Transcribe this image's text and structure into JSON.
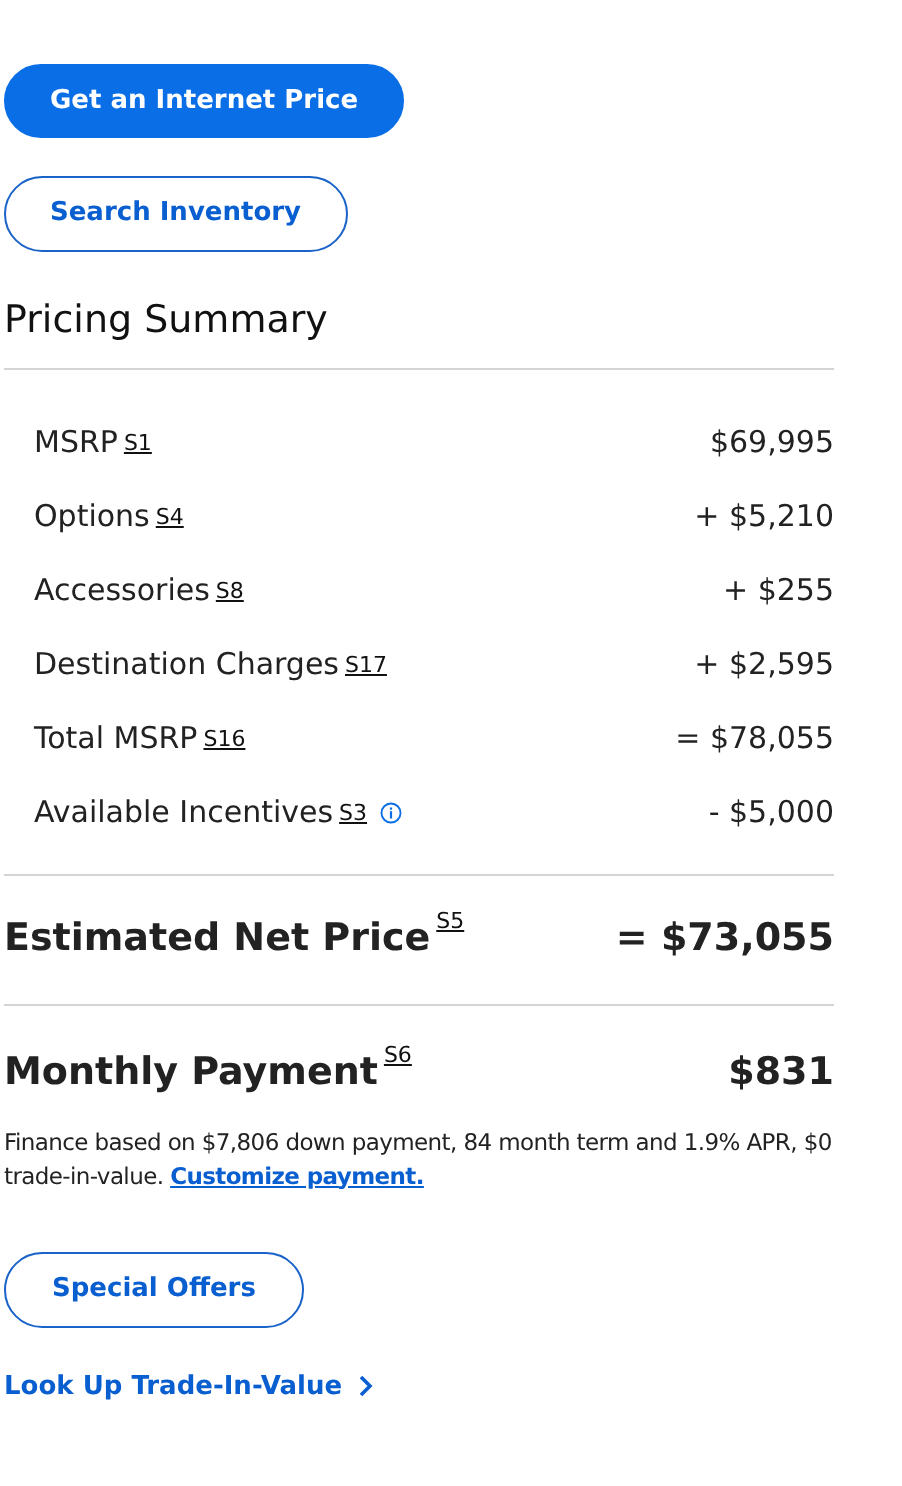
{
  "actions": [
    {
      "label": "Get an Internet Price",
      "kind": "primary"
    },
    {
      "label": "Search Inventory",
      "kind": "outline"
    }
  ],
  "pricing_summary": {
    "title": "Pricing Summary",
    "rows": [
      {
        "label": "MSRP",
        "note": "S1",
        "value": "$69,995",
        "info": false
      },
      {
        "label": "Options",
        "note": "S4",
        "value": "+ $5,210",
        "info": false
      },
      {
        "label": "Accessories",
        "note": "S8",
        "value": "+ $255",
        "info": false
      },
      {
        "label": "Destination Charges",
        "note": "S17",
        "value": "+ $2,595",
        "info": false
      },
      {
        "label": "Total MSRP",
        "note": "S16",
        "value": "= $78,055",
        "info": false
      },
      {
        "label": "Available Incentives",
        "note": "S3",
        "value": "- $5,000",
        "info": true
      }
    ],
    "net_price": {
      "label": "Estimated Net Price",
      "note": "S5",
      "value": "= $73,055"
    },
    "monthly_payment": {
      "label": "Monthly Payment",
      "note": "S6",
      "value": "$831"
    },
    "finance_text": "Finance based on $7,806 down payment, 84 month term and 1.9% APR, $0 trade-in-value.",
    "customize_link": "Customize payment."
  },
  "special_offers": "Special Offers",
  "trade_in_link": "Look Up Trade-In-Value"
}
